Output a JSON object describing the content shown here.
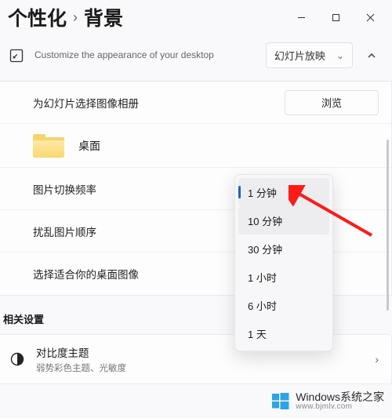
{
  "breadcrumb": {
    "first": "个性化",
    "second": "背景"
  },
  "subtitle": "Customize the appearance of your desktop",
  "bg_mode_selected": "幻灯片放映",
  "row_album": "为幻灯片选择图像相册",
  "browse_label": "浏览",
  "folder_name": "桌面",
  "row_interval": "图片切换频率",
  "row_shuffle": "扰乱图片顺序",
  "row_fit": "选择适合你的桌面图像",
  "related_heading": "相关设置",
  "contrast": {
    "title": "对比度主题",
    "sub": "弱势彩色主题、光敏度"
  },
  "interval_options": [
    "1 分钟",
    "10 分钟",
    "30 分钟",
    "1 小时",
    "6 小时",
    "1 天"
  ],
  "watermark": {
    "line1": "Windows系统之家",
    "line2": "www.bjmlv.com"
  }
}
